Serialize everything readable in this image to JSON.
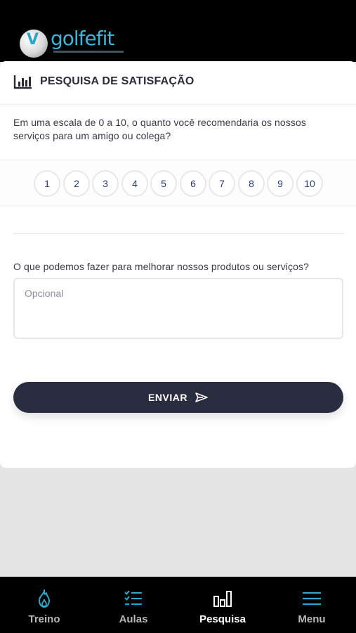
{
  "app": {
    "logo_text": "golfefit",
    "accent": "#2aa7c9"
  },
  "card": {
    "title": "PESQUISA DE SATISFAÇÃO",
    "title_icon": "bar-chart-icon"
  },
  "survey": {
    "question": "Em uma escala de 0 a 10, o quanto você recomendaria os nossos serviços para um amigo ou colega?",
    "scale": [
      "1",
      "2",
      "3",
      "4",
      "5",
      "6",
      "7",
      "8",
      "9",
      "10"
    ],
    "feedback_question": "O que podemos fazer para melhorar nossos produtos ou serviços?",
    "feedback_placeholder": "Opcional",
    "feedback_value": "",
    "submit_label": "ENVIAR",
    "submit_icon": "send-icon"
  },
  "nav": {
    "items": [
      {
        "label": "Treino",
        "icon": "flame-icon",
        "active": false
      },
      {
        "label": "Aulas",
        "icon": "checklist-icon",
        "active": false
      },
      {
        "label": "Pesquisa",
        "icon": "bar-chart-icon",
        "active": true
      },
      {
        "label": "Menu",
        "icon": "hamburger-icon",
        "active": false
      }
    ]
  }
}
